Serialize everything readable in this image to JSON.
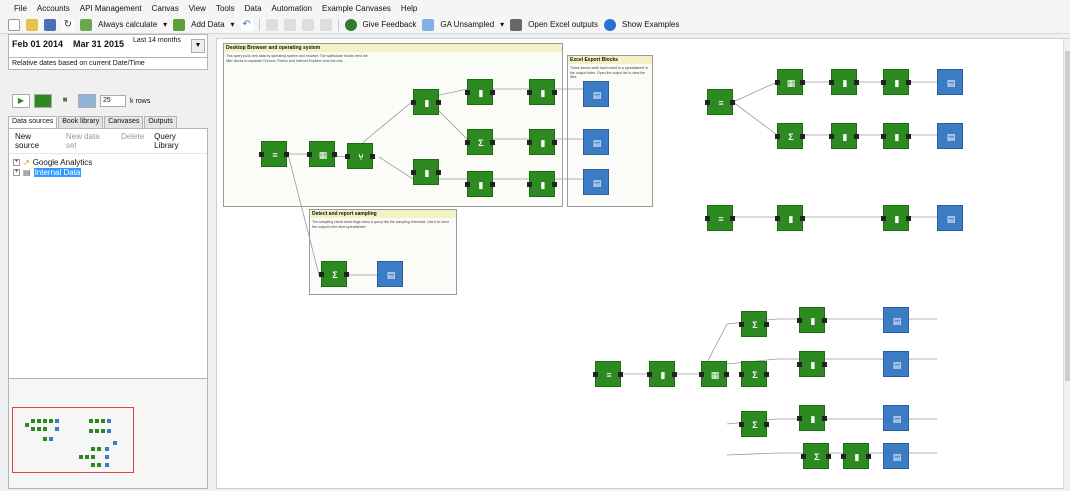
{
  "menu": [
    "File",
    "Accounts",
    "API Management",
    "Canvas",
    "View",
    "Tools",
    "Data",
    "Automation",
    "Example Canvases",
    "Help"
  ],
  "toolbar": {
    "always_calculate": "Always calculate",
    "add_data": "Add Data",
    "give_feedback": "Give Feedback",
    "ga_unsampled": "GA Unsampled",
    "open_excel": "Open Excel outputs",
    "show_examples": "Show Examples"
  },
  "dates": {
    "start": "Feb 01 2014",
    "end": "Mar 31 2015",
    "preset": "Last 14 months",
    "relative": "Relative dates based on current Date/Time"
  },
  "rows": {
    "value": "25",
    "label": "k rows"
  },
  "tabs": [
    "Data sources",
    "Book library",
    "Canvases",
    "Outputs"
  ],
  "datasources_bar": {
    "new_source": "New source",
    "new_dataset": "New data set",
    "delete": "Delete",
    "query_library": "Query Library"
  },
  "tree": [
    {
      "label": "Google Analytics"
    },
    {
      "label": "Internal Data",
      "selected": true
    }
  ],
  "groups": {
    "g1": {
      "title": "Desktop Browser and operating system",
      "body": "This query pulls new data by operating system and browser. The splitsdown blocks feed the filter blocks to separate Chrome, Firefox and Internet Explorer from the rest."
    },
    "g2": {
      "title": "Excel Export Blocks",
      "body": "These blocks write each result to a spreadsheet in the output folder. Open the output list to view the files."
    },
    "g3": {
      "title": "Detect and report sampling",
      "body": "The sampling check block flags when a query hits the sampling threshold. Use it to send the output to the alert spreadsheet."
    }
  },
  "colors": {
    "node_green": "#2d8a21",
    "node_blue": "#3b7cc4",
    "group_header": "#f4f1c4",
    "selection": "#3399ff"
  }
}
